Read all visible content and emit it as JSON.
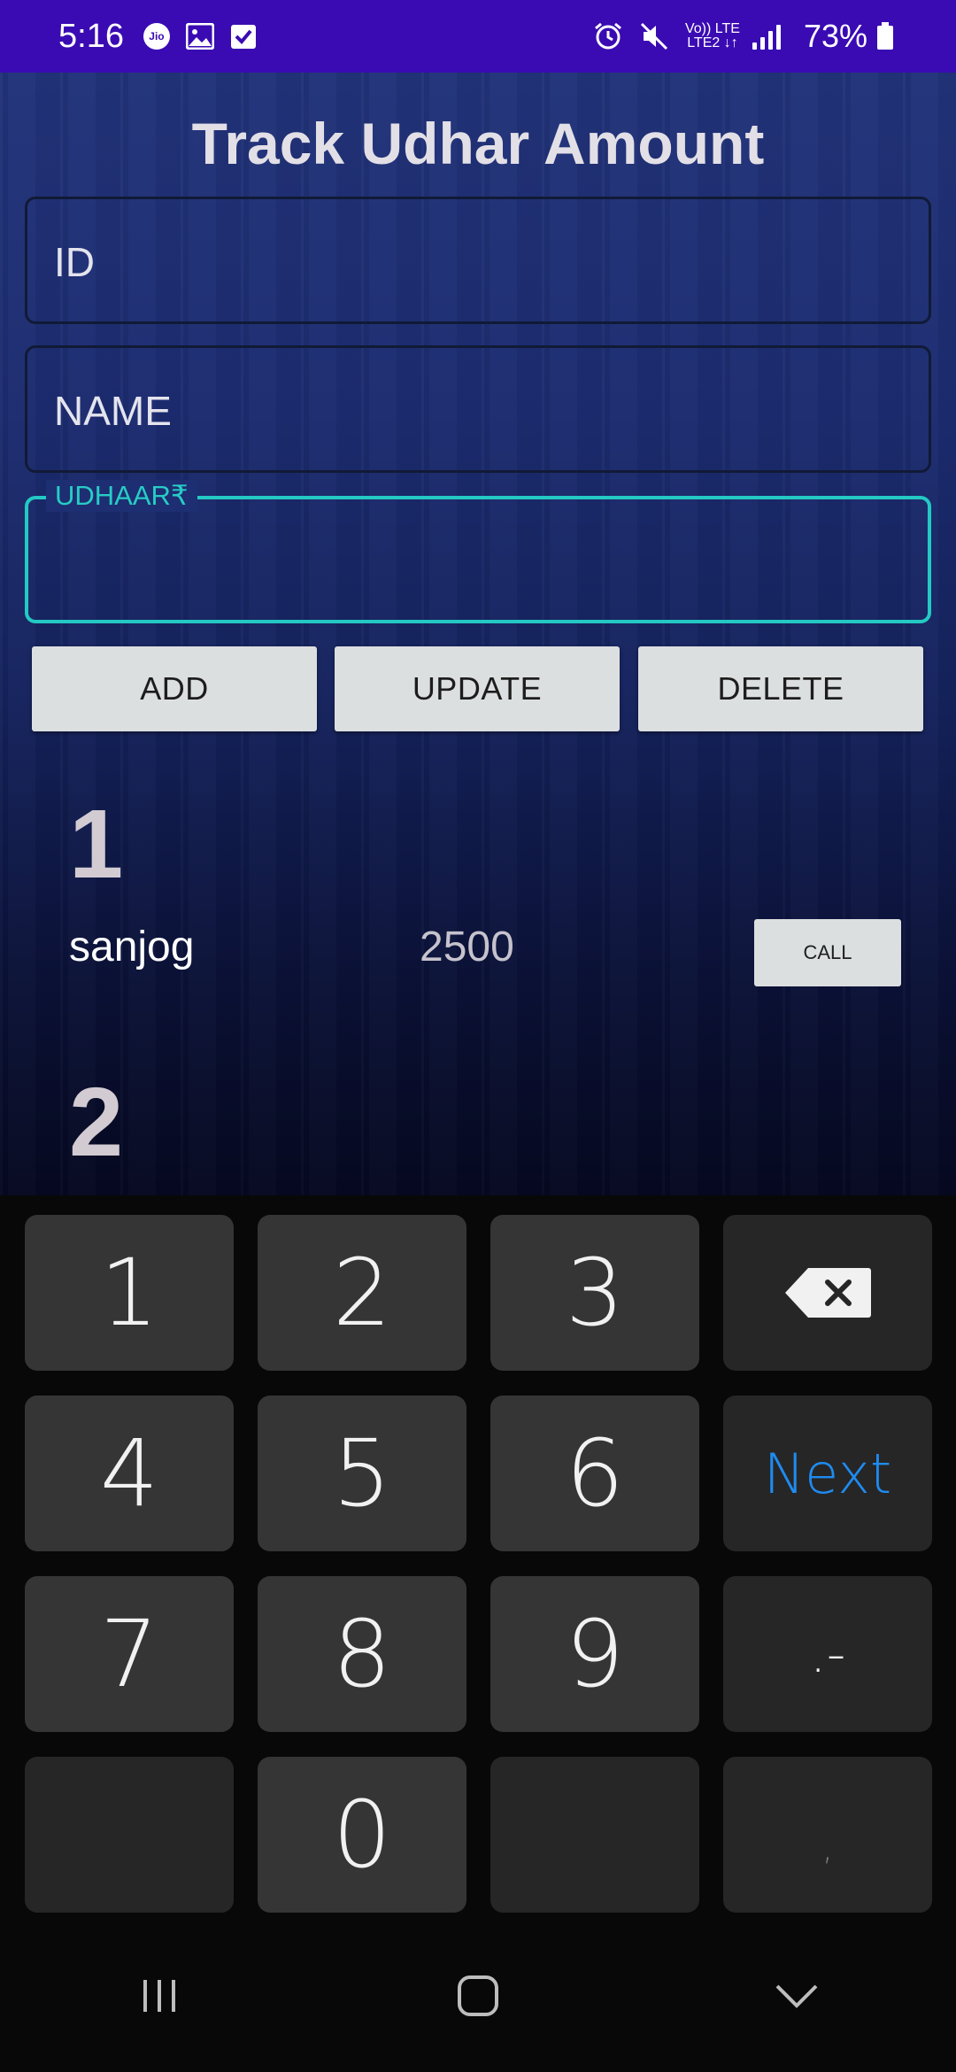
{
  "status_bar": {
    "time": "5:16",
    "jio_label": "Jio",
    "network_top": "Vo)) LTE",
    "network_bottom": "LTE2 ↓↑",
    "battery": "73%"
  },
  "app": {
    "title": "Track Udhar Amount",
    "fields": {
      "id_placeholder": "ID",
      "name_placeholder": "NAME",
      "udhaar_label": "UDHAAR₹"
    },
    "buttons": {
      "add": "ADD",
      "update": "UPDATE",
      "delete": "DELETE"
    },
    "records": [
      {
        "id": "1",
        "name": "sanjog",
        "amount": "2500",
        "call_label": "CALL"
      },
      {
        "id": "2"
      }
    ]
  },
  "keyboard": {
    "keys": [
      "1",
      "2",
      "3",
      "4",
      "5",
      "6",
      "Next",
      "7",
      "8",
      "9",
      ".-",
      "0",
      ","
    ],
    "backspace_icon": "backspace-icon"
  },
  "nav_bar": {
    "recents_icon": "recents-icon",
    "home_icon": "home-icon",
    "back_icon": "hide-keyboard-icon"
  }
}
